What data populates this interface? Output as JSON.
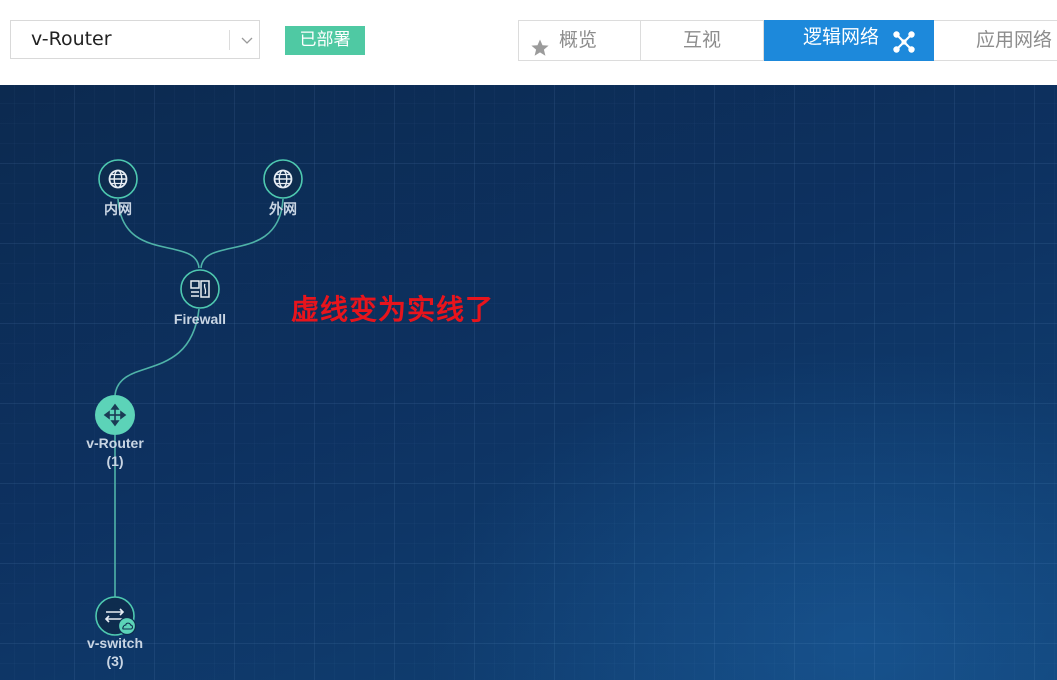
{
  "toolbar": {
    "device_select": {
      "value": "v-Router"
    },
    "status_badge": "已部署",
    "tabs": [
      {
        "label": "概览",
        "icon": "star-icon",
        "active": false
      },
      {
        "label": "互视",
        "active": false
      },
      {
        "label": "逻辑网络",
        "icon": "network-topology-icon",
        "active": true
      },
      {
        "label": "应用网络",
        "active": false
      }
    ]
  },
  "topology": {
    "nodes": [
      {
        "label": "内网",
        "icon": "globe-icon"
      },
      {
        "label": "外网",
        "icon": "globe-icon"
      },
      {
        "label": "Firewall",
        "icon": "firewall-icon"
      },
      {
        "label": "v-Router",
        "count": "(1)",
        "icon": "router-icon",
        "highlighted": true
      },
      {
        "label": "v-switch",
        "count": "(3)",
        "icon": "switch-icon",
        "sub_icon": "cloud-icon"
      }
    ],
    "annotation": "虚线变为实线了"
  },
  "colors": {
    "accent": "#1d89db",
    "badge": "#4fc9a3",
    "node_stroke": "#4ec9b0",
    "link": "#4fb3a8",
    "annotation": "#e8141c",
    "canvas": "#0d3160"
  }
}
